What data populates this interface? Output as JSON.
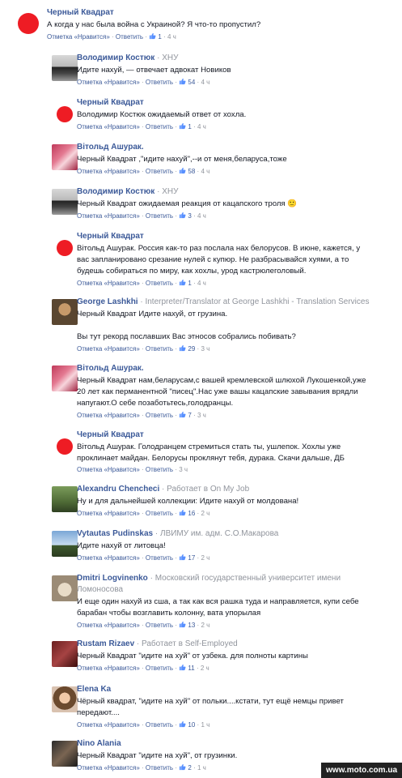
{
  "comments": [
    {
      "name": "Черный Квадрат",
      "sub": "",
      "text": [
        "А когда у нас была война с Украиной? Я что-то пропустил?"
      ],
      "reply": "Отметка «Нравится»",
      "answer": "Ответить",
      "likes": "1",
      "time": "4 ч",
      "avatar": "red"
    },
    {
      "name": "Володимир Костюк",
      "sub": "ХНУ",
      "text": [
        "Идите нахуй, — отвечает адвокат Новиков"
      ],
      "reply": "Отметка «Нравится»",
      "answer": "Ответить",
      "likes": "54",
      "time": "4 ч",
      "avatar": "car"
    },
    {
      "name": "Черный Квадрат",
      "sub": "",
      "text": [
        "Володимир Костюк ожидаемый ответ от хохла."
      ],
      "reply": "Отметка «Нравится»",
      "answer": "Ответить",
      "likes": "1",
      "time": "4 ч",
      "avatar": "red"
    },
    {
      "name": "Вітольд Ашурак.",
      "sub": "",
      "text": [
        "Черный Квадрат ,\"идите нахуй\",--и от меня,беларуса,тоже"
      ],
      "reply": "Отметка «Нравится»",
      "answer": "Ответить",
      "likes": "58",
      "time": "4 ч",
      "avatar": "pink"
    },
    {
      "name": "Володимир Костюк",
      "sub": "ХНУ",
      "text": [
        "Черный Квадрат ожидаемая реакция от кацапского троля 🙂"
      ],
      "reply": "Отметка «Нравится»",
      "answer": "Ответить",
      "likes": "3",
      "time": "4 ч",
      "avatar": "car"
    },
    {
      "name": "Черный Квадрат",
      "sub": "",
      "text": [
        "Вітольд Ашурак. Россия как-то раз послала нах белорусов. В июне, кажется, у",
        "вас запланировано срезание нулей с купюр. Не разбрасывайся хуями, а то",
        "будешь собираться по миру, как хохлы, урод кастрюлеголовый."
      ],
      "reply": "Отметка «Нравится»",
      "answer": "Ответить",
      "likes": "1",
      "time": "4 ч",
      "avatar": "red"
    },
    {
      "name": "George Lashkhi",
      "sub": "Interpreter/Translator at George Lashkhi - Translation Services",
      "text": [
        "Черный Квадрат Идите нахуй, от грузина.",
        "",
        "Вы тут рекорд пославших Вас этносов собрались побивать?"
      ],
      "reply": "Отметка «Нравится»",
      "answer": "Ответить",
      "likes": "29",
      "time": "3 ч",
      "avatar": "man"
    },
    {
      "name": "Вітольд Ашурак.",
      "sub": "",
      "text": [
        "Черный Квадрат нам,беларусам,с вашей кремлевской шлюхой Лукошенкой,уже",
        "20 лет как перманентной \"писец\".Нас уже вашы кацапские завывания врядли",
        "напугают.О себе позаботьтесь,голодранцы."
      ],
      "reply": "Отметка «Нравится»",
      "answer": "Ответить",
      "likes": "7",
      "time": "3 ч",
      "avatar": "pink"
    },
    {
      "name": "Черный Квадрат",
      "sub": "",
      "text": [
        "Вітольд Ашурак. Голодранцем стремиться стать ты, ушлепок. Хохлы уже",
        "проклинает майдан. Белорусы проклянут тебя, дурака. Скачи дальше, ДБ"
      ],
      "reply": "Отметка «Нравится»",
      "answer": "Ответить",
      "likes": "",
      "time": "3 ч",
      "avatar": "red"
    },
    {
      "name": "Alexandru Chencheci",
      "sub": "Работает в On My Job",
      "text": [
        "Ну и для дальнейшей коллекции: Идите нахуй от молдована!"
      ],
      "reply": "Отметка «Нравится»",
      "answer": "Ответить",
      "likes": "16",
      "time": "2 ч",
      "avatar": "green"
    },
    {
      "name": "Vytautas Pudinskas",
      "sub": "ЛВИМУ им. адм. С.О.Макарова",
      "text": [
        "Идите нахуй от литовца!"
      ],
      "reply": "Отметка «Нравится»",
      "answer": "Ответить",
      "likes": "17",
      "time": "2 ч",
      "avatar": "sky"
    },
    {
      "name": "Dmitri Logvinenko",
      "sub": "Московский государственный университет имени",
      "sub2": "Ломоносова",
      "text": [
        "И еще один нахуй из сша, а так как вся рашка туда и направляется, купи себе",
        "барабан чтобы возглавить колонну, вата упорылая"
      ],
      "reply": "Отметка «Нравится»",
      "answer": "Ответить",
      "likes": "13",
      "time": "2 ч",
      "avatar": "dog"
    },
    {
      "name": "Rustam Rizaev",
      "sub": "Работает в Self-Employed",
      "text": [
        "Черный Квадрат \"идите на хуй\" от узбека. для полноты картины"
      ],
      "reply": "Отметка «Нравится»",
      "answer": "Ответить",
      "likes": "11",
      "time": "2 ч",
      "avatar": "book"
    },
    {
      "name": "Elena Ka",
      "sub": "",
      "text": [
        "Чёрный квадрат, \"идите на хуй\" от польки....кстати, тут ещё немцы привет",
        "передают...."
      ],
      "reply": "Отметка «Нравится»",
      "answer": "Ответить",
      "likes": "10",
      "time": "1 ч",
      "avatar": "woman"
    },
    {
      "name": "Nino Alania",
      "sub": "",
      "text": [
        "Черный Квадрат \"идите на хуй\", от грузинки."
      ],
      "reply": "Отметка «Нравится»",
      "answer": "Ответить",
      "likes": "2",
      "time": "1 ч",
      "avatar": "nino"
    }
  ],
  "watermark": "www.moto.com.ua"
}
